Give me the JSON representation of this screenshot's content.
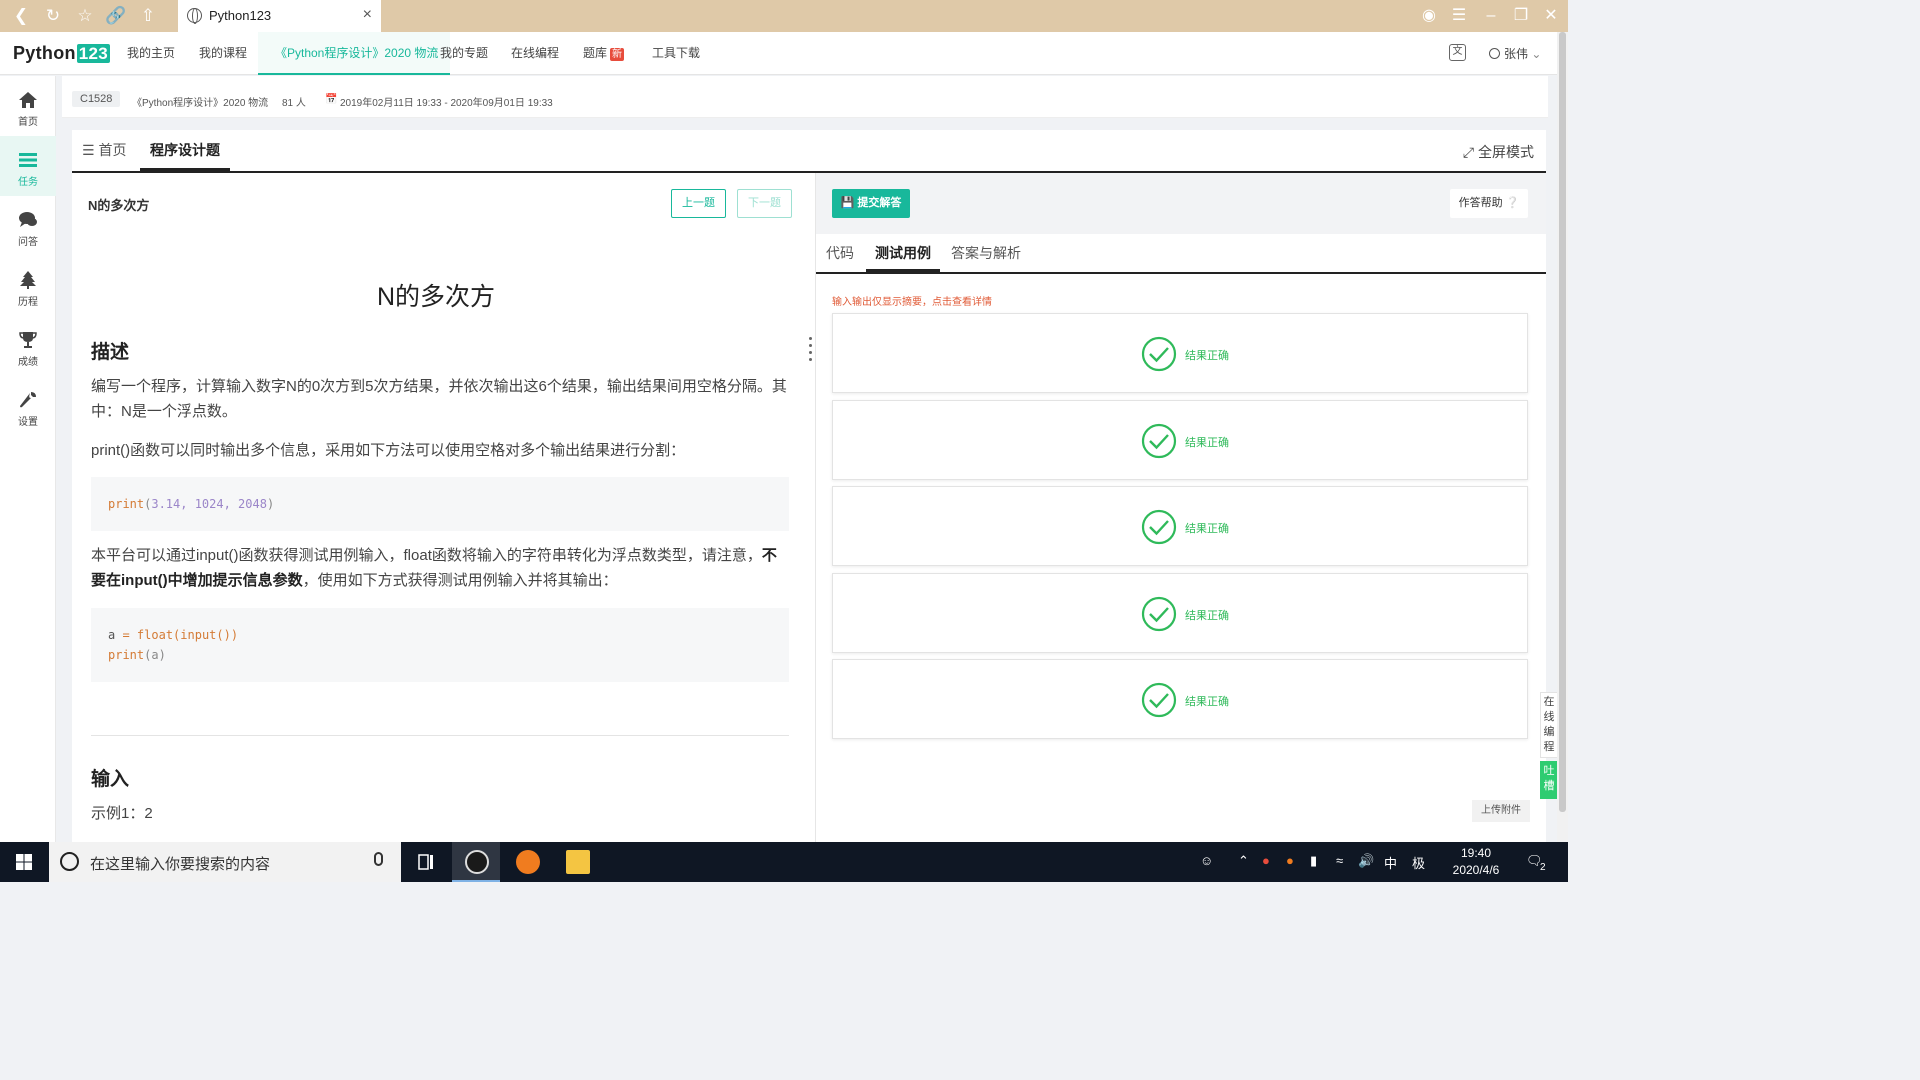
{
  "browser": {
    "tab_title": "Python123",
    "tab_close": "×"
  },
  "header": {
    "logo_text": "Python",
    "logo_num": "123",
    "nav": [
      {
        "label": "我的主页"
      },
      {
        "label": "我的课程"
      },
      {
        "label": "《Python程序设计》2020 物流"
      },
      {
        "label": "我的专题"
      },
      {
        "label": "在线编程"
      },
      {
        "label": "题库",
        "badge": "新"
      },
      {
        "label": "工具下载"
      }
    ],
    "user_name": "张伟"
  },
  "sidebar": {
    "items": [
      {
        "label": "首页",
        "icon": "home-icon"
      },
      {
        "label": "任务",
        "icon": "tasks-icon"
      },
      {
        "label": "问答",
        "icon": "comments-icon"
      },
      {
        "label": "历程",
        "icon": "tree-icon"
      },
      {
        "label": "成绩",
        "icon": "trophy-icon"
      },
      {
        "label": "设置",
        "icon": "wrench-icon"
      }
    ]
  },
  "course": {
    "code": "C1528",
    "name": "《Python程序设计》2020 物流",
    "members": "81 人",
    "period": "2019年02月11日 19:33 - 2020年09月01日 19:33"
  },
  "tabs": {
    "home": "首页",
    "program": "程序设计题",
    "fullscreen": "全屏模式"
  },
  "problem": {
    "short_title": "N的多次方",
    "prev_label": "上一题",
    "next_label": "下一题",
    "heading": "N的多次方",
    "desc_title": "描述",
    "desc_p1": "编写一个程序，计算输入数字N的0次方到5次方结果，并依次输出这6个结果，输出结果间用空格分隔。其中：N是一个浮点数。",
    "desc_p2": "print()函数可以同时输出多个信息，采用如下方法可以使用空格对多个输出结果进行分割：",
    "code1_fn": "print",
    "code1_args": "3.14, 1024, 2048",
    "desc_p3_a": "本平台可以通过input()函数获得测试用例输入，float函数将输入的字符串转化为浮点数类型，请注意，",
    "desc_p3_bold": "不要在input()中增加提示信息参数",
    "desc_p3_b": "，使用如下方式获得测试用例输入并将其输出：",
    "code2_line1_var": "a",
    "code2_line1_eq": " = ",
    "code2_line1_rest": "float(input())",
    "code2_line2_fn": "print",
    "code2_line2_arg": "(a)",
    "input_title": "输入",
    "input_example": "示例1：2"
  },
  "right": {
    "submit_label": "提交解答",
    "help_label": "作答帮助",
    "tabs": [
      "代码",
      "测试用例",
      "答案与解析"
    ],
    "io_note": "输入输出仅显示摘要，点击查看详情",
    "results": [
      "结果正确",
      "结果正确",
      "结果正确",
      "结果正确",
      "结果正确"
    ],
    "upload_label": "上传附件"
  },
  "float_widgets": {
    "online_code": "在线编程",
    "feedback": "吐槽"
  },
  "taskbar": {
    "search_placeholder": "在这里输入你要搜索的内容",
    "ime_lang": "中",
    "ime_mode": "极",
    "time": "19:40",
    "date": "2020/4/6",
    "notify_count": "2"
  },
  "colors": {
    "accent": "#18b89b",
    "success": "#2fba5a",
    "warning": "#e05a36",
    "browser_bar": "#dfc9a8",
    "taskbar": "#0f1724"
  }
}
